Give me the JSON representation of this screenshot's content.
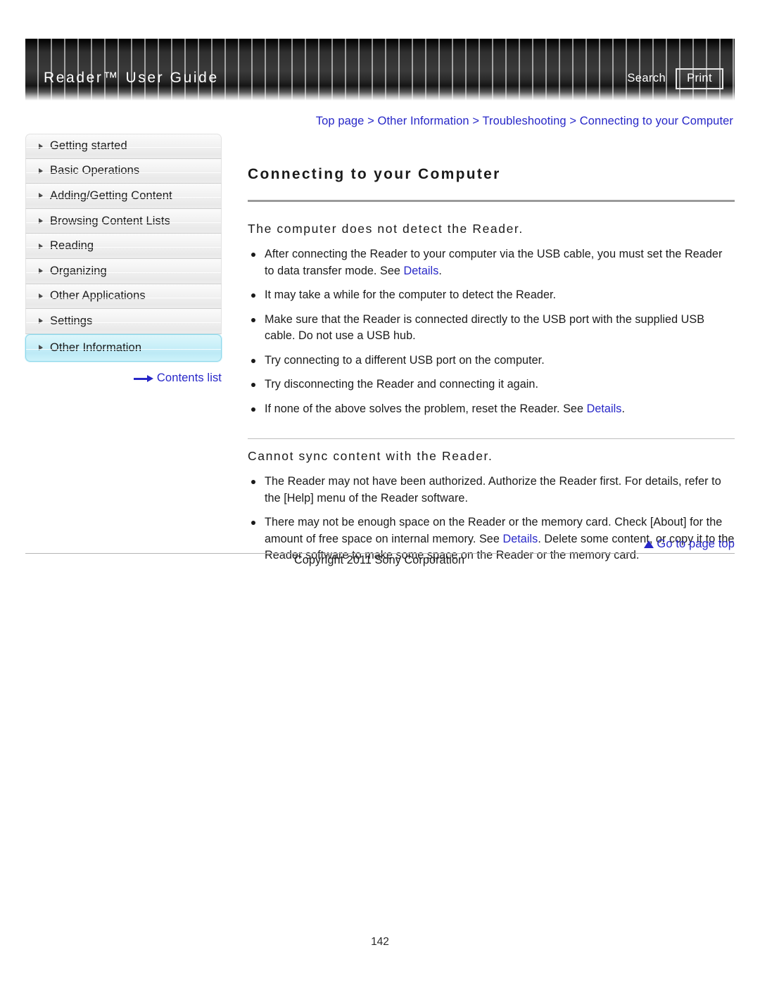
{
  "header": {
    "title": "Reader™ User Guide",
    "search_label": "Search",
    "print_label": "Print"
  },
  "breadcrumb": {
    "text": "Top page > Other Information > Troubleshooting > Connecting to your Computer"
  },
  "sidebar": {
    "items": [
      {
        "label": "Getting started",
        "active": false
      },
      {
        "label": "Basic Operations",
        "active": false
      },
      {
        "label": "Adding/Getting Content",
        "active": false
      },
      {
        "label": "Browsing Content Lists",
        "active": false
      },
      {
        "label": "Reading",
        "active": false
      },
      {
        "label": "Organizing",
        "active": false
      },
      {
        "label": "Other Applications",
        "active": false
      },
      {
        "label": "Settings",
        "active": false
      },
      {
        "label": "Other Information",
        "active": true
      }
    ],
    "contents_link_label": "Contents list"
  },
  "main": {
    "page_title": "Connecting to your Computer",
    "sections": [
      {
        "heading": "The computer does not detect the Reader.",
        "bullets": [
          {
            "pre": "After connecting the Reader to your computer via the USB cable, you must set the Reader to data transfer mode. See ",
            "link": "Details",
            "post": "."
          },
          {
            "pre": "It may take a while for the computer to detect the Reader.",
            "link": "",
            "post": ""
          },
          {
            "pre": "Make sure that the Reader is connected directly to the USB port with the supplied USB cable. Do not use a USB hub.",
            "link": "",
            "post": ""
          },
          {
            "pre": "Try connecting to a different USB port on the computer.",
            "link": "",
            "post": ""
          },
          {
            "pre": "Try disconnecting the Reader and connecting it again.",
            "link": "",
            "post": ""
          },
          {
            "pre": "If none of the above solves the problem, reset the Reader. See ",
            "link": "Details",
            "post": "."
          }
        ]
      },
      {
        "heading": "Cannot sync content with the Reader.",
        "bullets": [
          {
            "pre": "The Reader may not have been authorized. Authorize the Reader first. For details, refer to the [Help] menu of the Reader software.",
            "link": "",
            "post": ""
          },
          {
            "pre": "There may not be enough space on the Reader or the memory card. Check [About] for the amount of free space on internal memory. See ",
            "link": "Details",
            "post": ". Delete some content, or copy it to the Reader software to make some space on the Reader or the memory card."
          }
        ]
      }
    ]
  },
  "footer": {
    "go_to_top_label": "Go to page top",
    "copyright": "Copyright 2011 Sony Corporation",
    "page_number": "142"
  },
  "colors": {
    "link": "#2727c8",
    "active_nav": "#cdf1f9",
    "header_bg": "#3a3a3a"
  }
}
